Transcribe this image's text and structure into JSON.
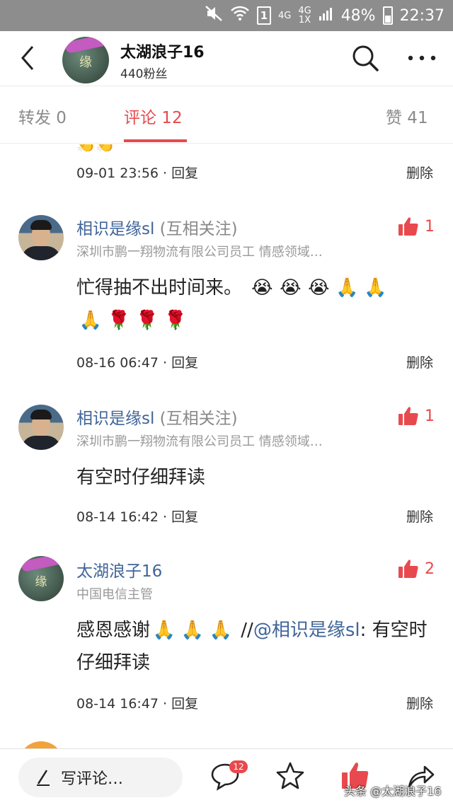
{
  "status_bar": {
    "network_1": "4G",
    "network_2_top": "4G",
    "network_2_bottom": "1X",
    "sim_label": "1",
    "battery": "48%",
    "time": "22:37"
  },
  "header": {
    "title": "太湖浪子16",
    "subtitle": "440粉丝",
    "avatar_text": "缘"
  },
  "tabs": {
    "forward": "转发 0",
    "comment": "评论 12",
    "like": "赞 41"
  },
  "colors": {
    "accent": "#e8494e",
    "link": "#406599"
  },
  "comments": [
    {
      "time_reply": "09-01 23:56 · 回复",
      "delete": "删除"
    },
    {
      "name": "相识是缘sl",
      "relation": " (互相关注)",
      "desc": "深圳市鹏一翔物流有限公司员工 情感领域…",
      "likes": "1",
      "text": "忙得抽不出时间来。",
      "emojis_line1": [
        "😭",
        "😭",
        "😭",
        "🙏",
        "🙏"
      ],
      "emojis_line2": [
        "🙏",
        "🌹",
        "🌹",
        "🌹"
      ],
      "time_reply": "08-16 06:47 · 回复",
      "delete": "删除"
    },
    {
      "name": "相识是缘sl",
      "relation": " (互相关注)",
      "desc": "深圳市鹏一翔物流有限公司员工 情感领域…",
      "likes": "1",
      "text": "有空时仔细拜读",
      "time_reply": "08-14 16:42 · 回复",
      "delete": "删除"
    },
    {
      "name": "太湖浪子16",
      "desc": "中国电信主管",
      "likes": "2",
      "text_prefix": "感恩感谢",
      "emojis": [
        "🙏",
        "🙏",
        "🙏"
      ],
      "text_sep": " //",
      "mention": "@相识是缘sl",
      "text_suffix": ": 有空时仔细拜读",
      "time_reply": "08-14 16:47 · 回复",
      "delete": "删除",
      "avatar_text": "缘"
    }
  ],
  "bottom_bar": {
    "write_placeholder": "写评论…",
    "comment_count": "12",
    "watermark": "头条 @太湖浪子16"
  }
}
